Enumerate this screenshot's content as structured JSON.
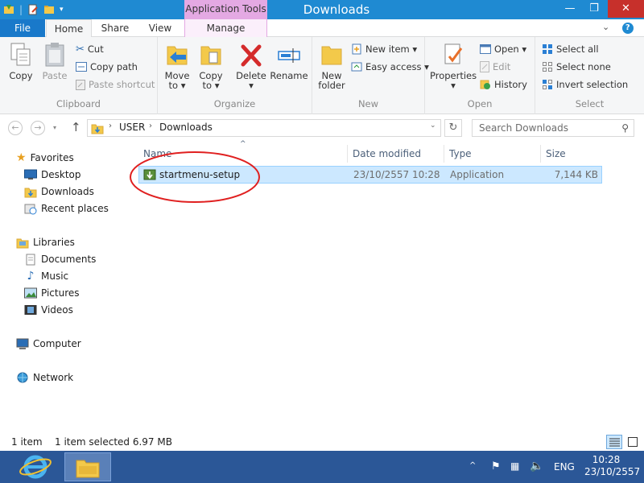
{
  "window": {
    "title": "Downloads",
    "contextual_tab_header": "Application Tools",
    "min_glyph": "—",
    "max_glyph": "❐",
    "close_glyph": "✕"
  },
  "tabs": {
    "file": "File",
    "home": "Home",
    "share": "Share",
    "view": "View",
    "manage": "Manage"
  },
  "ribbon": {
    "clipboard": {
      "label": "Clipboard",
      "copy": "Copy",
      "paste": "Paste",
      "cut": "Cut",
      "copy_path": "Copy path",
      "paste_shortcut": "Paste shortcut"
    },
    "organize": {
      "label": "Organize",
      "move_to_1": "Move",
      "move_to_2": "to ▾",
      "copy_to_1": "Copy",
      "copy_to_2": "to ▾",
      "delete": "Delete",
      "delete_2": "▾",
      "rename": "Rename"
    },
    "new": {
      "label": "New",
      "new_folder_1": "New",
      "new_folder_2": "folder",
      "new_item": "New item ▾",
      "easy_access": "Easy access ▾"
    },
    "open": {
      "label": "Open",
      "properties": "Properties",
      "properties_2": "▾",
      "open": "Open ▾",
      "edit": "Edit",
      "history": "History"
    },
    "select": {
      "label": "Select",
      "select_all": "Select all",
      "select_none": "Select none",
      "invert_selection": "Invert selection"
    }
  },
  "address": {
    "crumbs": [
      "USER",
      "Downloads"
    ],
    "search_placeholder": "Search Downloads"
  },
  "nav": {
    "favorites": "Favorites",
    "desktop": "Desktop",
    "downloads": "Downloads",
    "recent_places": "Recent places",
    "libraries": "Libraries",
    "documents": "Documents",
    "music": "Music",
    "pictures": "Pictures",
    "videos": "Videos",
    "computer": "Computer",
    "network": "Network"
  },
  "columns": {
    "name": "Name",
    "date_modified": "Date modified",
    "type": "Type",
    "size": "Size"
  },
  "files": [
    {
      "name": "startmenu-setup",
      "date_modified": "23/10/2557 10:28",
      "type": "Application",
      "size": "7,144 KB"
    }
  ],
  "status": {
    "item_count": "1 item",
    "selected": "1 item selected  6.97 MB"
  },
  "taskbar": {
    "language": "ENG",
    "time": "10:28",
    "date": "23/10/2557"
  },
  "colors": {
    "titlebar": "#1f8ad2",
    "file_tab": "#1979ca",
    "contextual": "#e4a9e3",
    "selection": "#cce8ff",
    "taskbar": "#2b5797",
    "annotation": "#e02020"
  }
}
